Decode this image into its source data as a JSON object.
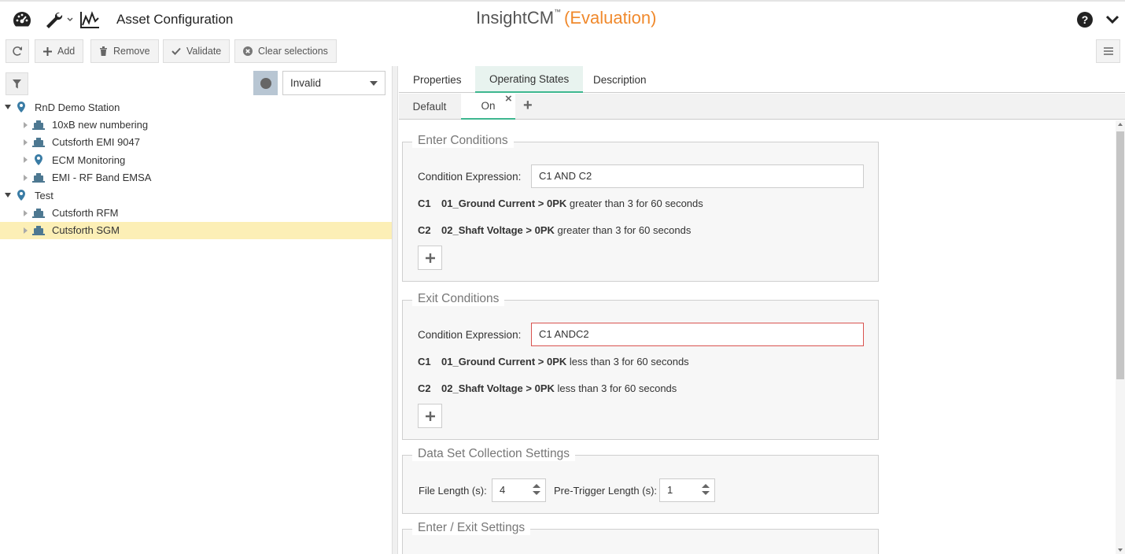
{
  "header": {
    "title": "Asset Configuration",
    "brand_name": "InsightCM",
    "brand_tm": "™",
    "brand_mode": "(Evaluation)"
  },
  "icons": {
    "dashboard": "dashboard-icon",
    "tools": "wrench-icon",
    "trend": "trend-icon",
    "help": "help-icon",
    "menu_chevron": "chevron-down-icon",
    "hamburger": "hamburger-icon"
  },
  "toolbar": {
    "add_label": "Add",
    "remove_label": "Remove",
    "validate_label": "Validate",
    "clear_label": "Clear selections"
  },
  "filter": {
    "selected_value": "Invalid"
  },
  "tree": {
    "nodes": [
      {
        "label": "RnD Demo Station",
        "type": "location",
        "expanded": true
      },
      {
        "label": "10xB new numbering",
        "type": "asset"
      },
      {
        "label": "Cutsforth EMI 9047",
        "type": "asset"
      },
      {
        "label": "ECM Monitoring",
        "type": "location"
      },
      {
        "label": "EMI - RF Band EMSA",
        "type": "asset"
      },
      {
        "label": "Test",
        "type": "location",
        "expanded": true
      },
      {
        "label": "Cutsforth RFM",
        "type": "asset"
      },
      {
        "label": "Cutsforth SGM",
        "type": "asset",
        "selected": true
      }
    ]
  },
  "tabs": {
    "properties": "Properties",
    "operating_states": "Operating States",
    "description": "Description",
    "active": "Operating States"
  },
  "subtabs": {
    "default": "Default",
    "on": "On",
    "close_glyph": "×",
    "add_glyph": "+"
  },
  "enter": {
    "legend": "Enter Conditions",
    "expr_label": "Condition Expression:",
    "expr_value": "C1 AND C2",
    "c1_id": "C1",
    "c1_channel": "01_Ground Current > 0PK",
    "c1_rule": "greater than 3 for 60 seconds",
    "c2_id": "C2",
    "c2_channel": "02_Shaft Voltage > 0PK",
    "c2_rule": "greater than 3 for 60 seconds"
  },
  "exit": {
    "legend": "Exit Conditions",
    "expr_label": "Condition Expression:",
    "expr_value": "C1 ANDC2",
    "c1_id": "C1",
    "c1_channel": "01_Ground Current > 0PK",
    "c1_rule": "less than 3 for 60 seconds",
    "c2_id": "C2",
    "c2_channel": "02_Shaft Voltage > 0PK",
    "c2_rule": "less than 3 for 60 seconds"
  },
  "dataset": {
    "legend": "Data Set Collection Settings",
    "file_length_label": "File Length (s):",
    "file_length_value": "4",
    "pretrigger_label": "Pre-Trigger Length (s):",
    "pretrigger_value": "1"
  },
  "enter_exit": {
    "legend": "Enter / Exit Settings"
  },
  "colors": {
    "accent": "#3eb78f",
    "brand_eval": "#f0892c",
    "selected_row": "#fcefb6",
    "invalid_border": "#d9534f",
    "location_pin": "#3a7ca5",
    "asset_icon": "#4d7891"
  }
}
